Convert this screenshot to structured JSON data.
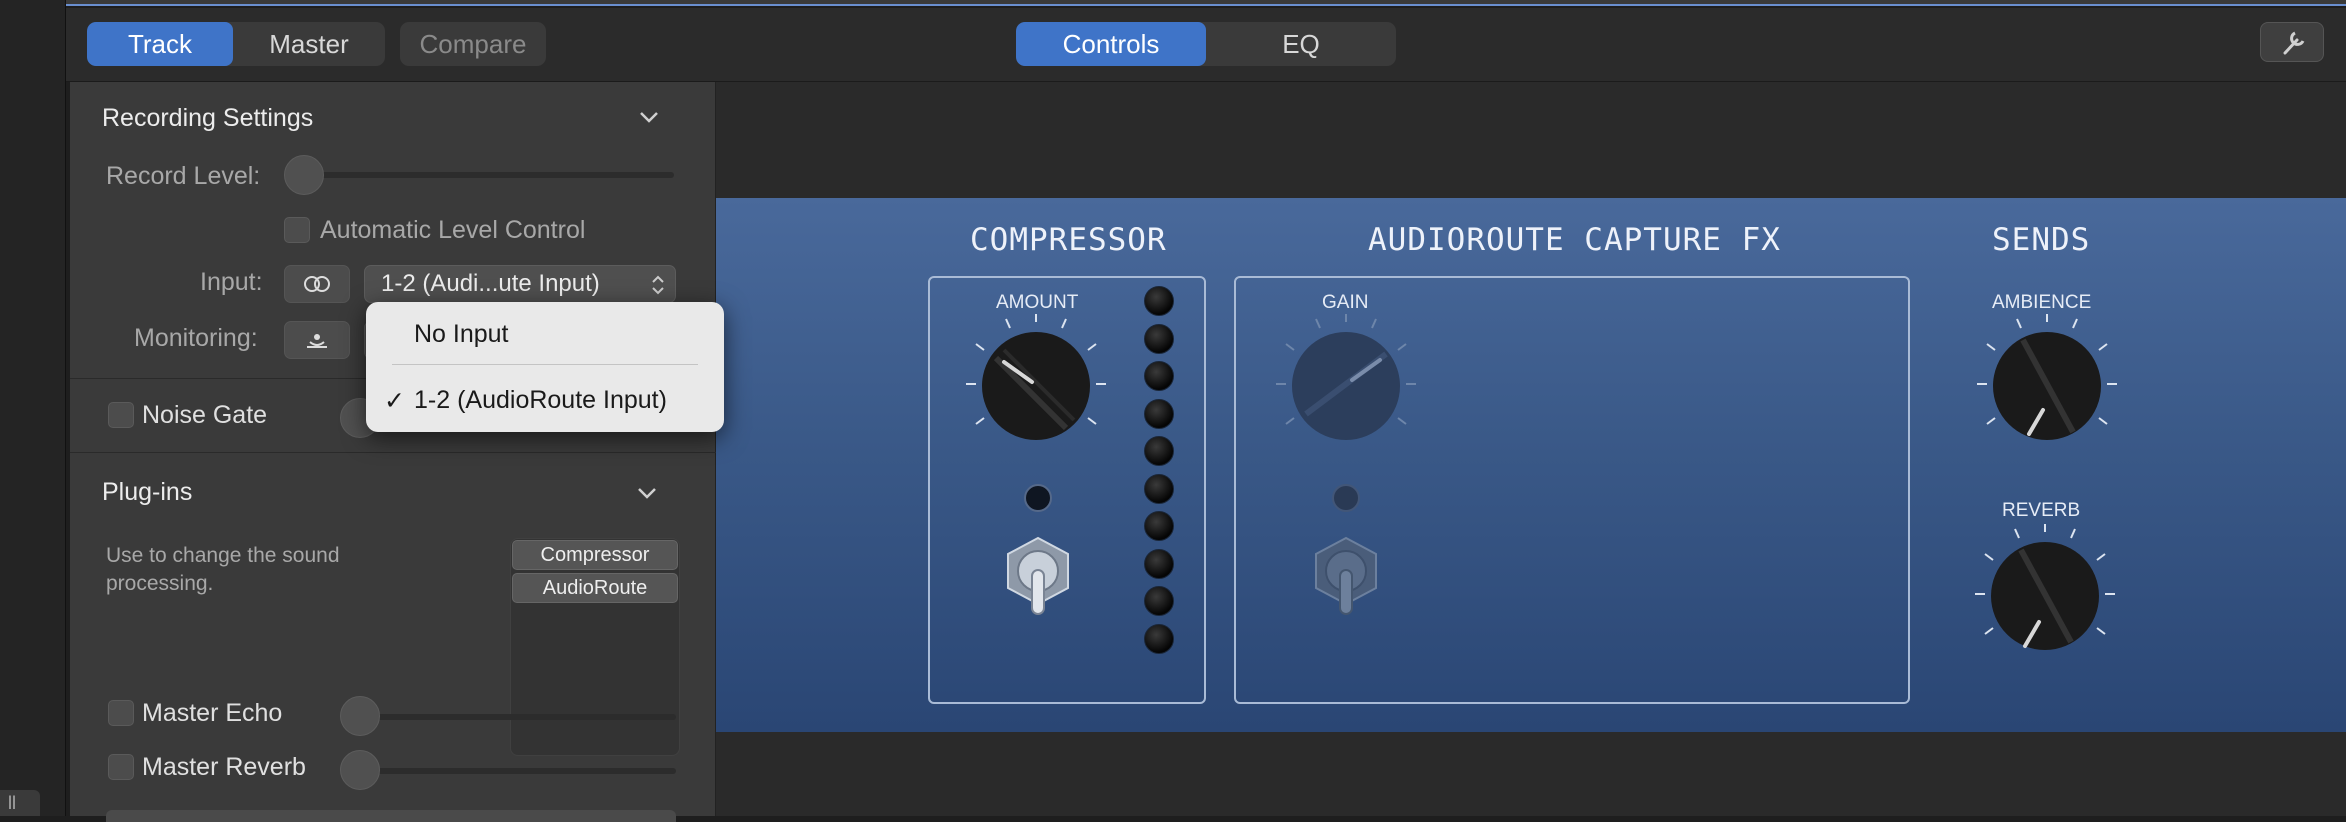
{
  "toolbar": {
    "left_tabs": [
      {
        "label": "Track",
        "active": true
      },
      {
        "label": "Master",
        "active": false
      }
    ],
    "compare_label": "Compare",
    "view_tabs": [
      {
        "label": "Controls",
        "active": true
      },
      {
        "label": "EQ",
        "active": false
      }
    ]
  },
  "recording_settings": {
    "title": "Recording Settings",
    "record_level_label": "Record Level:",
    "record_level_value": 0,
    "auto_level_label": "Automatic Level Control",
    "input_label": "Input:",
    "input_value": "1-2  (Audi...ute Input)",
    "monitoring_label": "Monitoring:",
    "noise_gate_label": "Noise Gate"
  },
  "input_menu": {
    "items": [
      {
        "label": "No Input",
        "checked": false
      },
      {
        "label": "1-2  (AudioRoute Input)",
        "checked": true
      }
    ],
    "check_mark": "✓"
  },
  "plugins": {
    "title": "Plug-ins",
    "description": "Use to change the sound processing.",
    "slots": [
      "Compressor",
      "AudioRoute"
    ]
  },
  "master": {
    "echo_label": "Master Echo",
    "reverb_label": "Master Reverb"
  },
  "plugin_panel": {
    "compressor": {
      "title": "COMPRESSOR",
      "amount_label": "AMOUNT",
      "meter_leds": 10
    },
    "capture": {
      "title": "AUDIOROUTE CAPTURE FX",
      "gain_label": "GAIN"
    },
    "sends": {
      "title": "SENDS",
      "ambience_label": "AMBIENCE",
      "reverb_label": "REVERB"
    }
  },
  "colors": {
    "accent": "#3f74c8",
    "panel_blue": "#3a5988",
    "inspector_bg": "#3a3a3a"
  },
  "corner_label": "ll"
}
